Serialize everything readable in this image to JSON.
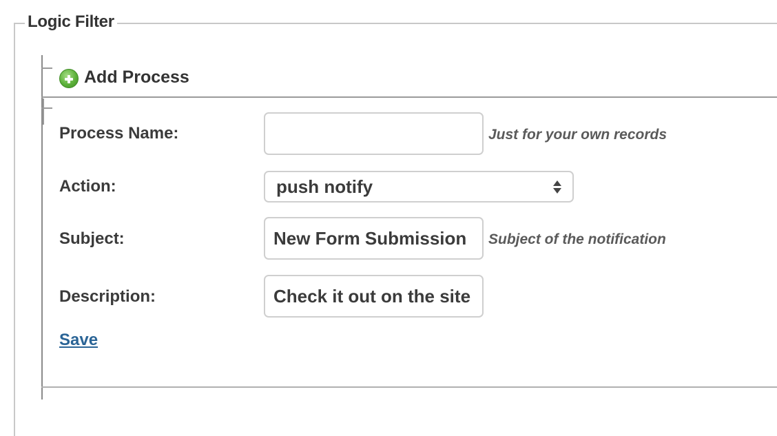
{
  "fieldset": {
    "legend": "Logic Filter"
  },
  "process": {
    "add_label": "Add Process",
    "fields": {
      "process_name": {
        "label": "Process Name:",
        "value": "",
        "hint": "Just for your own records"
      },
      "action": {
        "label": "Action:",
        "selected": "push notify"
      },
      "subject": {
        "label": "Subject:",
        "value": "New Form Submission",
        "hint": "Subject of the notification"
      },
      "description": {
        "label": "Description:",
        "value": "Check it out on the site"
      }
    },
    "save_label": "Save"
  },
  "icons": {
    "add": "plus-circle-icon",
    "select": "chevron-updown-icon"
  },
  "colors": {
    "accent_link": "#2a6496",
    "add_icon": "#5cb13a"
  }
}
